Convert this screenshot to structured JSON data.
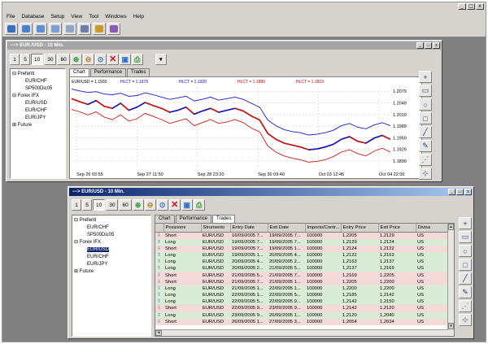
{
  "app": {
    "menu": [
      "File",
      "Database",
      "Setup",
      "View",
      "Tool",
      "Windows",
      "Help"
    ],
    "sys_buttons": [
      "_",
      "□",
      "x"
    ],
    "toolbar_icons": [
      {
        "name": "open-icon",
        "color": "#3a6fc6"
      },
      {
        "name": "save-icon",
        "color": "#4a82d0"
      },
      {
        "name": "chart-icon",
        "color": "#5d8fd6"
      },
      {
        "name": "database-icon",
        "color": "#7aa0d8"
      },
      {
        "name": "tools-icon",
        "color": "#8fa6c9"
      },
      {
        "name": "print-icon",
        "color": "#6d7fa8"
      },
      {
        "name": "brush-icon",
        "color": "#c79a2a"
      },
      {
        "name": "info-icon",
        "color": "#8a58b8"
      }
    ]
  },
  "chart_window": {
    "title": "---> EUR./USD - 10 Min.",
    "periods": [
      "1",
      "5",
      "10",
      "30",
      "60"
    ],
    "selected_period": "10",
    "tabs": [
      "Chart",
      "Performance",
      "Trades"
    ],
    "selected_tab": "Chart",
    "tree": [
      {
        "label": "Preferiti",
        "prefix": "⊟"
      },
      {
        "label": "EUR/CHF",
        "indent": 2
      },
      {
        "label": "SP500Dic05",
        "indent": 2
      },
      {
        "label": "Forex IFX",
        "prefix": "⊟"
      },
      {
        "label": "EUR/USD",
        "indent": 2
      },
      {
        "label": "EUR/CHF",
        "indent": 2
      },
      {
        "label": "EUR/JPY",
        "indent": 2
      },
      {
        "label": "Future",
        "prefix": "⊞"
      }
    ],
    "indicators": [
      "EUR/USD = 1.1930",
      "HLCT = 1.1979",
      "HLCT = 1.1920",
      "HLCT = 1.1880",
      "HLCT = 1.1819"
    ],
    "indicator_colors": [
      "#000000",
      "#0000c0",
      "#0000c0",
      "#c00000",
      "#c00000"
    ]
  },
  "chart_data": {
    "type": "line",
    "x_ticks": [
      "Sep 26 03:55",
      "Sep 27 11:50",
      "Sep 28 23:20",
      "Sep 30 09:40",
      "Oct 03 12:45",
      "Oct 04 22:00"
    ],
    "y_ticks": [
      "1.2079",
      "1.2049",
      "1.2019",
      "1.1989",
      "1.1959",
      "1.1929",
      "1.1899"
    ],
    "ylim": [
      1.188,
      1.209
    ],
    "series": [
      {
        "name": "EUR/USD",
        "color": "#000000",
        "values": [
          1.206,
          1.2052,
          1.2045,
          1.2055,
          1.204,
          1.2035,
          1.2048,
          1.203,
          1.2038,
          1.205,
          1.2042,
          1.2035,
          1.2025,
          1.203,
          1.2038,
          1.202,
          1.2028,
          1.2035,
          1.2025,
          1.203,
          1.2035,
          1.2028,
          1.2015,
          1.2005,
          1.197,
          1.1955,
          1.1945,
          1.194,
          1.1935,
          1.1928,
          1.193,
          1.1935,
          1.1942,
          1.1955,
          1.1962,
          1.195,
          1.1945,
          1.1958,
          1.1965,
          1.1955
        ]
      },
      {
        "name": "HLCT upper",
        "color": "#1a1ad0",
        "values": [
          1.2085,
          1.208,
          1.2076,
          1.2078,
          1.2072,
          1.207,
          1.2074,
          1.2066,
          1.2068,
          1.2075,
          1.207,
          1.2064,
          1.2058,
          1.2062,
          1.2066,
          1.2054,
          1.2058,
          1.2064,
          1.2056,
          1.206,
          1.2064,
          1.2058,
          1.2048,
          1.2038,
          1.2005,
          1.199,
          1.198,
          1.1975,
          1.1972,
          1.1966,
          1.1968,
          1.1972,
          1.1978,
          1.199,
          1.1996,
          1.1986,
          1.1982,
          1.1992,
          1.1998,
          1.199
        ]
      },
      {
        "name": "HLCT lower",
        "color": "#d01a1a",
        "values": [
          1.2032,
          1.2026,
          1.2018,
          1.2026,
          1.2012,
          1.2006,
          1.2018,
          1.2002,
          1.2008,
          1.2022,
          1.2014,
          1.2006,
          1.1996,
          1.2002,
          1.2008,
          1.199,
          1.1998,
          1.2006,
          1.1996,
          1.2,
          1.2006,
          1.1998,
          1.1984,
          1.1974,
          1.1938,
          1.1922,
          1.1912,
          1.1906,
          1.1902,
          1.1896,
          1.1898,
          1.1902,
          1.191,
          1.1922,
          1.1928,
          1.1918,
          1.1912,
          1.1924,
          1.1932,
          1.1922
        ]
      }
    ]
  },
  "trades_window": {
    "title": "---> EUR/USD - 10 Min.",
    "periods": [
      "1",
      "5",
      "10",
      "30",
      "60"
    ],
    "selected_period": "10",
    "tabs": [
      "Chart",
      "Performance",
      "Trades"
    ],
    "selected_tab": "Trades",
    "tree": [
      {
        "label": "Preferiti",
        "prefix": "⊟"
      },
      {
        "label": "EUR/CHF",
        "indent": 2
      },
      {
        "label": "SP500Dic05",
        "indent": 2
      },
      {
        "label": "Forex IFX",
        "prefix": "⊟"
      },
      {
        "label": "EUR/USD",
        "indent": 2,
        "selected": true
      },
      {
        "label": "EUR/CHF",
        "indent": 2
      },
      {
        "label": "EUR/JPY",
        "indent": 2
      },
      {
        "label": "Future",
        "prefix": "⊞"
      }
    ],
    "columns": [
      "Posizione",
      "Strumento",
      "Entry Date",
      "Exit Date",
      "Importo/Contr...",
      "Entry Price",
      "Exit Price",
      "Divisa"
    ],
    "rows": [
      {
        "pos": "Short",
        "instr": "EUR/USD",
        "entry": "16/09/2005 7...",
        "exit": "19/09/2005 7...",
        "amount": "100000",
        "entry_price": "1,2205",
        "exit_price": "1,2129",
        "cur": "US"
      },
      {
        "pos": "Long",
        "instr": "EUR/USD",
        "entry": "19/09/2005 7...",
        "exit": "19/09/2005 7...",
        "amount": "100000",
        "entry_price": "1,2129",
        "exit_price": "1,2124",
        "cur": "US"
      },
      {
        "pos": "Short",
        "instr": "EUR/USD",
        "entry": "19/09/2005 7...",
        "exit": "19/09/2005 1...",
        "amount": "100000",
        "entry_price": "1,2124",
        "exit_price": "1,2122",
        "cur": "US"
      },
      {
        "pos": "Long",
        "instr": "EUR/USD",
        "entry": "19/09/2005 1...",
        "exit": "20/09/2005 4...",
        "amount": "100000",
        "entry_price": "1,2122",
        "exit_price": "1,2163",
        "cur": "US"
      },
      {
        "pos": "Long",
        "instr": "EUR/USD",
        "entry": "20/09/2005 4...",
        "exit": "20/09/2005 2...",
        "amount": "100000",
        "entry_price": "1,2163",
        "exit_price": "1,2137",
        "cur": "US"
      },
      {
        "pos": "Long",
        "instr": "EUR/USD",
        "entry": "20/09/2005 2...",
        "exit": "21/09/2005 5...",
        "amount": "100000",
        "entry_price": "1,2137",
        "exit_price": "1,2169",
        "cur": "US"
      },
      {
        "pos": "Short",
        "instr": "EUR/USD",
        "entry": "21/09/2005 5...",
        "exit": "21/09/2005 7...",
        "amount": "100000",
        "entry_price": "1,2169",
        "exit_price": "1,2205",
        "cur": "US"
      },
      {
        "pos": "Short",
        "instr": "EUR/USD",
        "entry": "21/09/2005 7...",
        "exit": "21/09/2005 1...",
        "amount": "100000",
        "entry_price": "1,2205",
        "exit_price": "1,2200",
        "cur": "US"
      },
      {
        "pos": "Long",
        "instr": "EUR/USD",
        "entry": "21/09/2005 1...",
        "exit": "22/09/2005 1...",
        "amount": "100000",
        "entry_price": "1,2200",
        "exit_price": "1,2200",
        "cur": "US"
      },
      {
        "pos": "Long",
        "instr": "EUR/USD",
        "entry": "22/09/2005 1...",
        "exit": "22/09/2005 5...",
        "amount": "100000",
        "entry_price": "1,2185",
        "exit_price": "1,2142",
        "cur": "US"
      },
      {
        "pos": "Long",
        "instr": "EUR/USD",
        "entry": "22/09/2005 5...",
        "exit": "22/09/2005 9...",
        "amount": "100000",
        "entry_price": "1,2142",
        "exit_price": "1,2150",
        "cur": "US"
      },
      {
        "pos": "Short",
        "instr": "EUR/USD",
        "entry": "22/09/2005 9...",
        "exit": "23/09/2005 9...",
        "amount": "100000",
        "entry_price": "1,2142",
        "exit_price": "1,2120",
        "cur": "US"
      },
      {
        "pos": "Long",
        "instr": "EUR/USD",
        "entry": "23/09/2005 9...",
        "exit": "26/09/2005 1...",
        "amount": "100000",
        "entry_price": "1,2120",
        "exit_price": "1,2040",
        "cur": "US"
      },
      {
        "pos": "Short",
        "instr": "EUR/USD",
        "entry": "26/09/2005 1...",
        "exit": "27/09/2005 3...",
        "amount": "100000",
        "entry_price": "1,2054",
        "exit_price": "1,2034",
        "cur": "US"
      }
    ]
  },
  "sidebar_tools": [
    {
      "name": "crosshair-icon",
      "glyph": "+"
    },
    {
      "name": "rectangle-fill-icon",
      "glyph": "▭"
    },
    {
      "name": "circle-icon",
      "glyph": "○"
    },
    {
      "name": "square-icon",
      "glyph": "□"
    },
    {
      "name": "trendline-icon",
      "glyph": "╱"
    },
    {
      "name": "pencil-icon",
      "glyph": "✎"
    },
    {
      "name": "fibonacci-icon",
      "glyph": "⋰"
    },
    {
      "name": "gann-icon",
      "glyph": "⊹"
    }
  ]
}
